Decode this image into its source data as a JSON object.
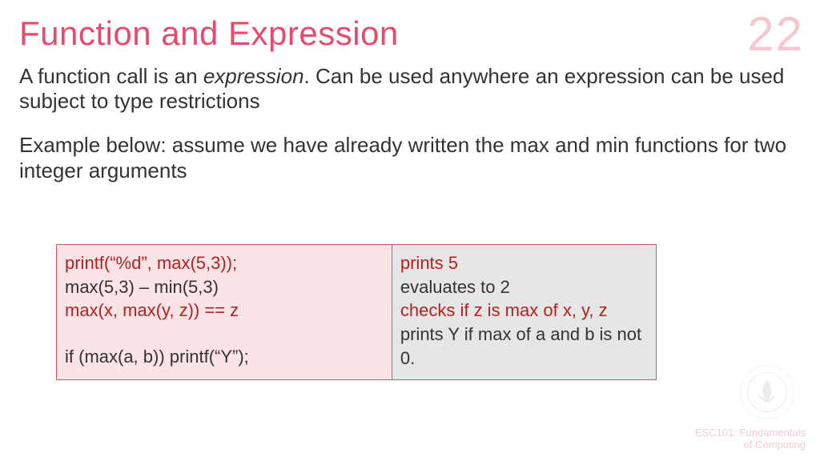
{
  "slideNumber": "22",
  "title": "Function and Expression",
  "para1_part1": "A function call is an ",
  "para1_em": "expression",
  "para1_part2": ". Can be used anywhere an expression can be used subject to type restrictions",
  "para2": "Example below: assume we have already written the max and min functions for two integer arguments",
  "left": {
    "r1": "printf(“%d”, max(5,3));",
    "r2": "max(5,3) – min(5,3)",
    "r3": "max(x, max(y, z)) == z",
    "r4": "if (max(a, b)) printf(“Y”);"
  },
  "right": {
    "r1": "prints 5",
    "r2": "evaluates to 2",
    "r3": "checks if z is max of x, y, z",
    "r4": "prints Y if max of a and b is not 0."
  },
  "footer": {
    "line1": "ESC101: Fundamentals",
    "line2": "of Computing"
  }
}
